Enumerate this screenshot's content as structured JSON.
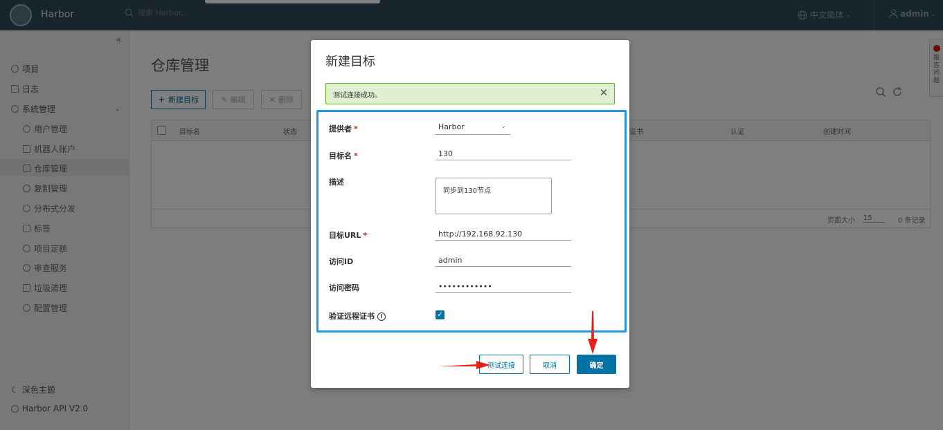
{
  "header": {
    "brand": "Harbor",
    "search_placeholder": "搜索 Harbor...",
    "language": "中文简体",
    "user": "admin"
  },
  "sidebar": {
    "items": [
      {
        "label": "项目"
      },
      {
        "label": "日志"
      },
      {
        "label": "系统管理"
      }
    ],
    "sub_items": [
      {
        "label": "用户管理"
      },
      {
        "label": "机器人账户"
      },
      {
        "label": "仓库管理"
      },
      {
        "label": "复制管理"
      },
      {
        "label": "分布式分发"
      },
      {
        "label": "标签"
      },
      {
        "label": "项目定额"
      },
      {
        "label": "审查服务"
      },
      {
        "label": "垃圾清理"
      },
      {
        "label": "配置管理"
      }
    ],
    "theme": "深色主题",
    "api": "Harbor API V2.0"
  },
  "main": {
    "title": "仓库管理",
    "toolbar": {
      "new": "新建目标",
      "edit": "编辑",
      "delete": "删除"
    },
    "columns": [
      "目标名",
      "状态",
      "证书",
      "认证",
      "创建时间"
    ],
    "footer": {
      "page_size_label": "页面大小",
      "page_size": "15",
      "count": "0 条记录"
    }
  },
  "feedback": {
    "label": "报告问题"
  },
  "modal": {
    "title": "新建目标",
    "alert": "测试连接成功。",
    "fields": {
      "provider_label": "提供者",
      "provider_value": "Harbor",
      "name_label": "目标名",
      "name_value": "130",
      "desc_label": "描述",
      "desc_value": "同步到130节点",
      "url_label": "目标URL",
      "url_value": "http://192.168.92.130",
      "access_id_label": "访问ID",
      "access_id_value": "admin",
      "password_label": "访问密码",
      "password_value": "••••••••••••",
      "verify_label": "验证远程证书",
      "verify_checked": true
    },
    "buttons": {
      "test": "测试连接",
      "cancel": "取消",
      "ok": "确定"
    }
  },
  "colors": {
    "header_bg": "#314a5b",
    "accent": "#0072a3",
    "highlight_border": "#2394e6",
    "arrow": "#e8201a",
    "success_bg": "#dff0d0",
    "success_border": "#60b515"
  }
}
